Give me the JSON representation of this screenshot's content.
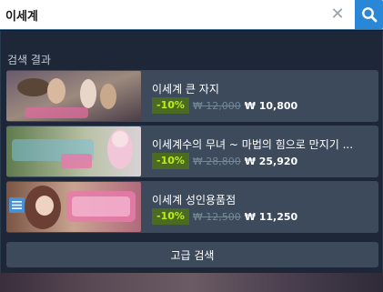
{
  "search": {
    "value": "이세계",
    "clear_glyph": "✕"
  },
  "results": {
    "section_label": "검색 결과",
    "items": [
      {
        "title": "이세계 큰 자지",
        "discount": "-10%",
        "original_price": "₩ 12,000",
        "final_price": "₩ 10,800",
        "thumb_caption": "이세계 큰 자지"
      },
      {
        "title": "이세계수의 무녀 ~ 마법의 힘으로 만지기 ...",
        "discount": "-10%",
        "original_price": "₩ 28,800",
        "final_price": "₩ 25,920",
        "thumb_caption": "이세계수의 무녀"
      },
      {
        "title": "이세계 성인용품점",
        "discount": "-10%",
        "original_price": "₩ 12,500",
        "final_price": "₩ 11,250",
        "thumb_caption": "이세계 성인용품점"
      }
    ]
  },
  "advanced_search_label": "고급 검색",
  "colors": {
    "search_button": "#2a86d6",
    "panel_bg": "#1d2737",
    "row_bg": "#3d4a5c",
    "discount_bg": "#4c6b22",
    "discount_text": "#beee11"
  },
  "icons": {
    "search": "search-icon",
    "clear": "close-icon",
    "list": "list-icon"
  }
}
